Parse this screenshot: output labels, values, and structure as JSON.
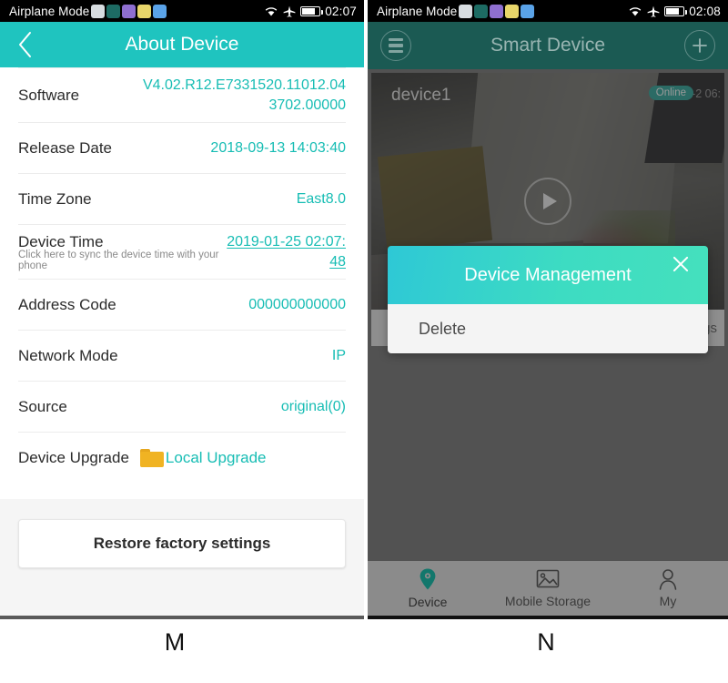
{
  "left": {
    "statusbar": {
      "label": "Airplane Mode",
      "time": "02:07",
      "icons": [
        "check-badge-icon",
        "camera-app-icon",
        "music-app-icon",
        "telegram-app-icon",
        "twitter-app-icon"
      ],
      "indicators": [
        "wifi-icon",
        "airplane-icon",
        "battery-icon"
      ]
    },
    "appbar": {
      "title": "About Device",
      "back": "back-chevron"
    },
    "rows": [
      {
        "label": "Software",
        "value": "V4.02.R12.E7331520.11012.043702.00000"
      },
      {
        "label": "Release Date",
        "value": "2018-09-13 14:03:40"
      },
      {
        "label": "Time Zone",
        "value": "East8.0"
      },
      {
        "label": "Device Time",
        "value": "2019-01-25 02:07:48",
        "sub": "Click here to sync the device time with your phone"
      },
      {
        "label": "Address Code",
        "value": "000000000000"
      },
      {
        "label": "Network Mode",
        "value": "IP"
      },
      {
        "label": "Source",
        "value": "original(0)"
      },
      {
        "label": "Device Upgrade",
        "value": "Local Upgrade"
      }
    ],
    "restore_button": "Restore factory settings",
    "caption": "M"
  },
  "right": {
    "statusbar": {
      "label": "Airplane Mode",
      "time": "02:08"
    },
    "appbar": {
      "title": "Smart Device",
      "menu": "hamburger-menu",
      "add": "plus-icon"
    },
    "device_card": {
      "name": "device1",
      "status_badge": "Online",
      "camera_timestamp": "2019-01-2  06:",
      "play": "play-icon",
      "action_label": "gs"
    },
    "dialog": {
      "title": "Device Management",
      "close": "close-icon",
      "items": [
        "Delete"
      ]
    },
    "tabs": [
      {
        "label": "Device",
        "icon": "location-pin-icon",
        "active": true
      },
      {
        "label": "Mobile Storage",
        "icon": "image-icon",
        "active": false
      },
      {
        "label": "My",
        "icon": "person-icon",
        "active": false
      }
    ],
    "caption": "N"
  },
  "colors": {
    "teal_appbar": "#1fc4bf",
    "teal_value": "#17bdb4",
    "dark_header": "#1b5a53",
    "badge_online": "#1aa093",
    "dialog_gradient_start": "#2ec8d6",
    "dialog_gradient_end": "#45e0bd",
    "tab_active": "#13776c"
  }
}
